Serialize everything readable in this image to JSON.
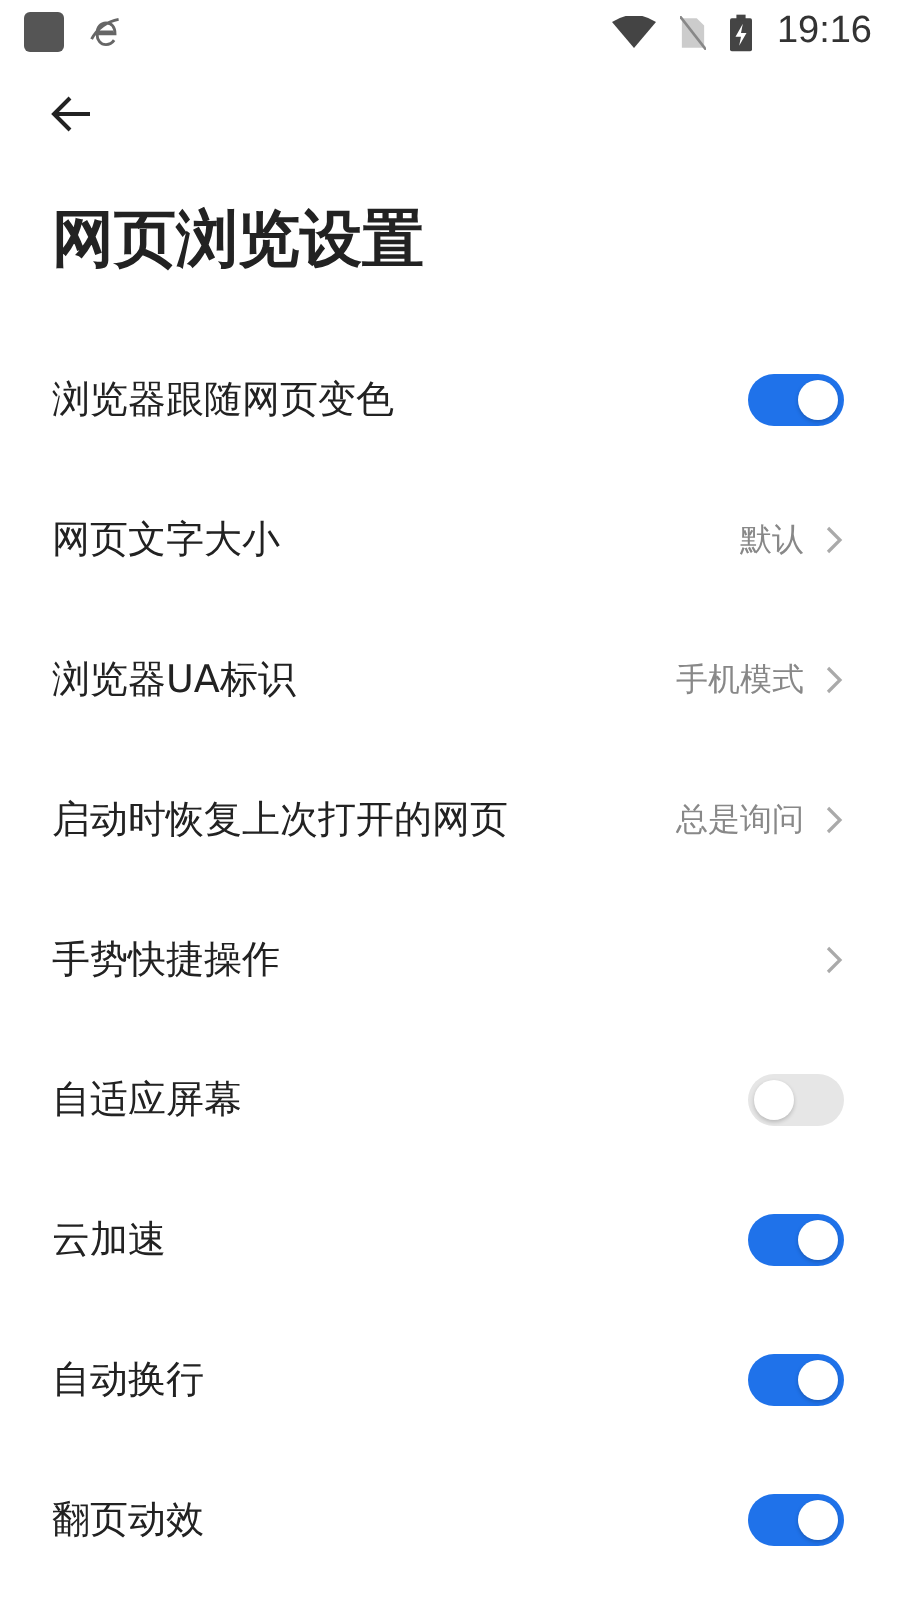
{
  "status_bar": {
    "time": "19:16"
  },
  "title": "网页浏览设置",
  "settings": [
    {
      "kind": "toggle",
      "label": "浏览器跟随网页变色",
      "on": true
    },
    {
      "kind": "link",
      "label": "网页文字大小",
      "value": "默认"
    },
    {
      "kind": "link",
      "label": "浏览器UA标识",
      "value": "手机模式"
    },
    {
      "kind": "link",
      "label": "启动时恢复上次打开的网页",
      "value": "总是询问"
    },
    {
      "kind": "link",
      "label": "手势快捷操作"
    },
    {
      "kind": "toggle",
      "label": "自适应屏幕",
      "on": false
    },
    {
      "kind": "toggle",
      "label": "云加速",
      "on": true
    },
    {
      "kind": "toggle",
      "label": "自动换行",
      "on": true
    },
    {
      "kind": "toggle",
      "label": "翻页动效",
      "on": true
    }
  ]
}
